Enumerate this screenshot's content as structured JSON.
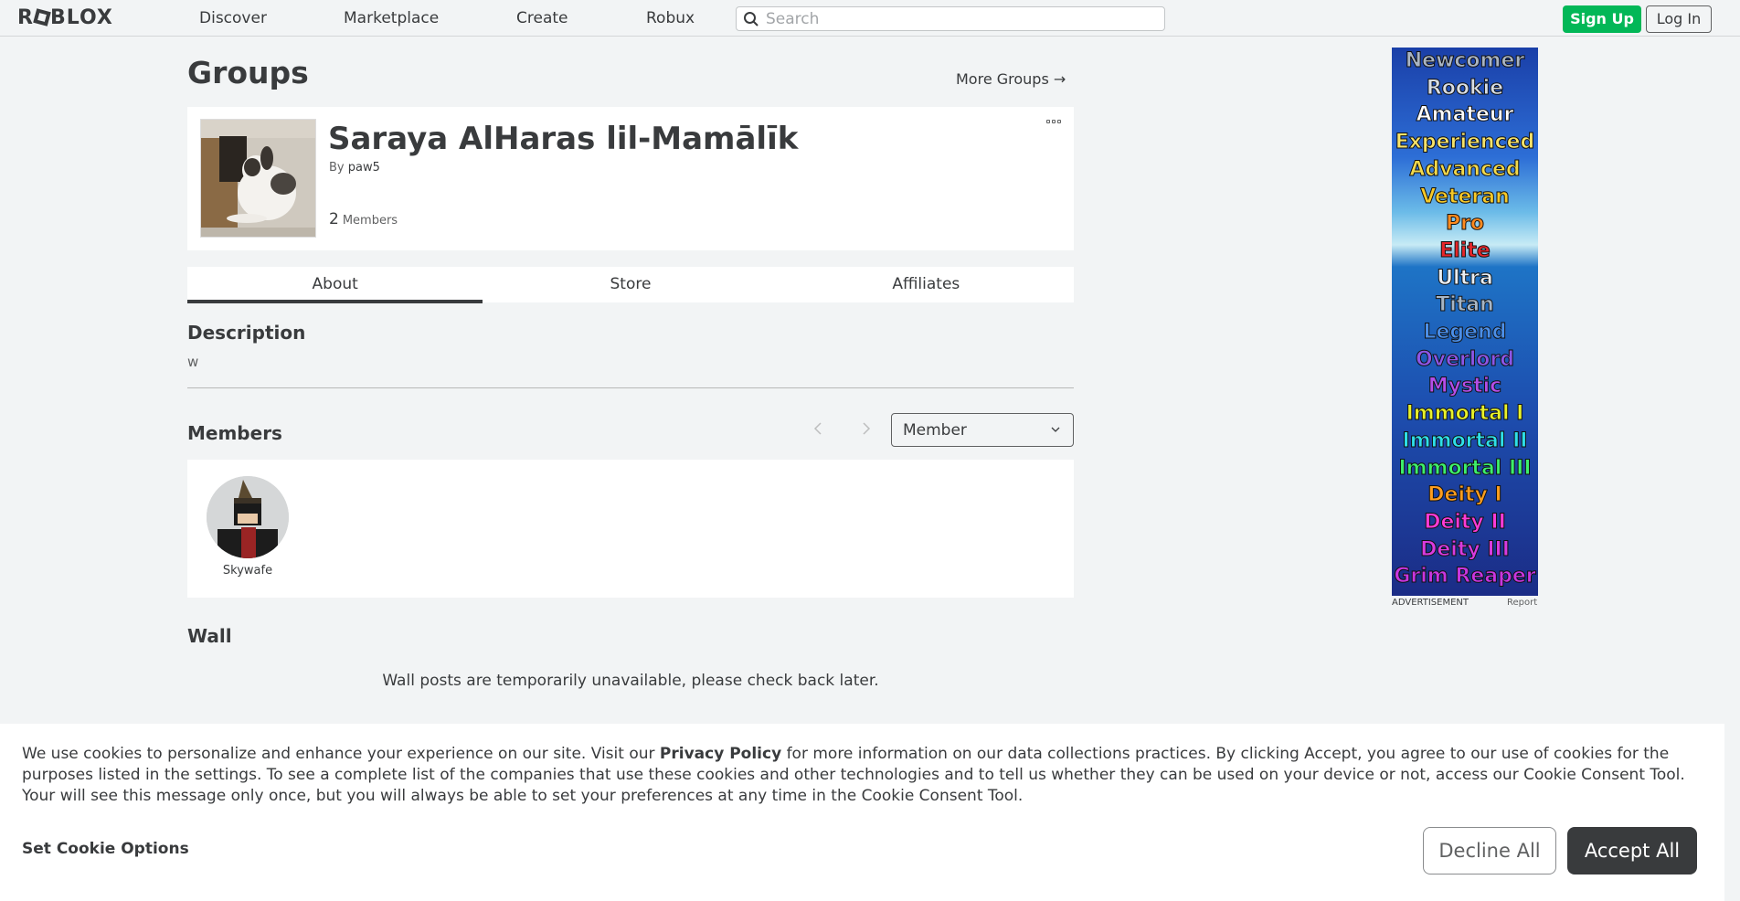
{
  "nav": {
    "logo": "ROBLOX",
    "links": [
      "Discover",
      "Marketplace",
      "Create",
      "Robux"
    ],
    "search_placeholder": "Search",
    "signup_label": "Sign Up",
    "login_label": "Log In"
  },
  "page": {
    "title": "Groups",
    "more_groups": "More Groups →"
  },
  "group": {
    "name": "Saraya AlHaras lil-Mamālīk",
    "by_label": "By",
    "owner": "paw5",
    "member_count": "2",
    "members_label": "Members"
  },
  "tabs": [
    "About",
    "Store",
    "Affiliates"
  ],
  "about": {
    "description_heading": "Description",
    "description_text": "w",
    "members_heading": "Members",
    "role_select_value": "Member",
    "members": [
      {
        "name": "Skywafe"
      }
    ],
    "wall_heading": "Wall",
    "wall_message": "Wall posts are temporarily unavailable, please check back later."
  },
  "ad": {
    "ranks": [
      {
        "text": "Newcomer",
        "color": "#a9b4c2"
      },
      {
        "text": "Rookie",
        "color": "#d8dde3"
      },
      {
        "text": "Amateur",
        "color": "#ffffff"
      },
      {
        "text": "Experienced",
        "color": "#f7e36a"
      },
      {
        "text": "Advanced",
        "color": "#f2d94c"
      },
      {
        "text": "Veteran",
        "color": "#f7c928"
      },
      {
        "text": "Pro",
        "color": "#ff8a1e"
      },
      {
        "text": "Elite",
        "color": "#e8262a"
      },
      {
        "text": "Ultra",
        "color": "#e9eef3"
      },
      {
        "text": "Titan",
        "color": "#a7b6c6"
      },
      {
        "text": "Legend",
        "color": "#4c8fe8"
      },
      {
        "text": "Overlord",
        "color": "#8d56e6"
      },
      {
        "text": "Mystic",
        "color": "#b54ee8"
      },
      {
        "text": "Immortal I",
        "color": "#e8f22a"
      },
      {
        "text": "Immortal II",
        "color": "#2ee0e8"
      },
      {
        "text": "Immortal III",
        "color": "#3df06a"
      },
      {
        "text": "Deity I",
        "color": "#ff9d1e"
      },
      {
        "text": "Deity II",
        "color": "#ff3bd8"
      },
      {
        "text": "Deity III",
        "color": "#d93be0"
      },
      {
        "text": "Grim Reaper",
        "color": "#c936e0"
      }
    ],
    "label": "ADVERTISEMENT",
    "report": "Report"
  },
  "cookie": {
    "text_before": "We use cookies to personalize and enhance your experience on our site. Visit our ",
    "privacy_link": "Privacy Policy",
    "text_after": " for more information on our data collections practices. By clicking Accept, you agree to our use of cookies for the purposes listed in the settings. To see a complete list of the companies that use these cookies and other technologies and to tell us whether they can be used on your device or not, access our Cookie Consent Tool. Your will see this message only once, but you will always be able to set your preferences at any time in the Cookie Consent Tool.",
    "set_options": "Set Cookie Options",
    "decline": "Decline All",
    "accept": "Accept All"
  }
}
